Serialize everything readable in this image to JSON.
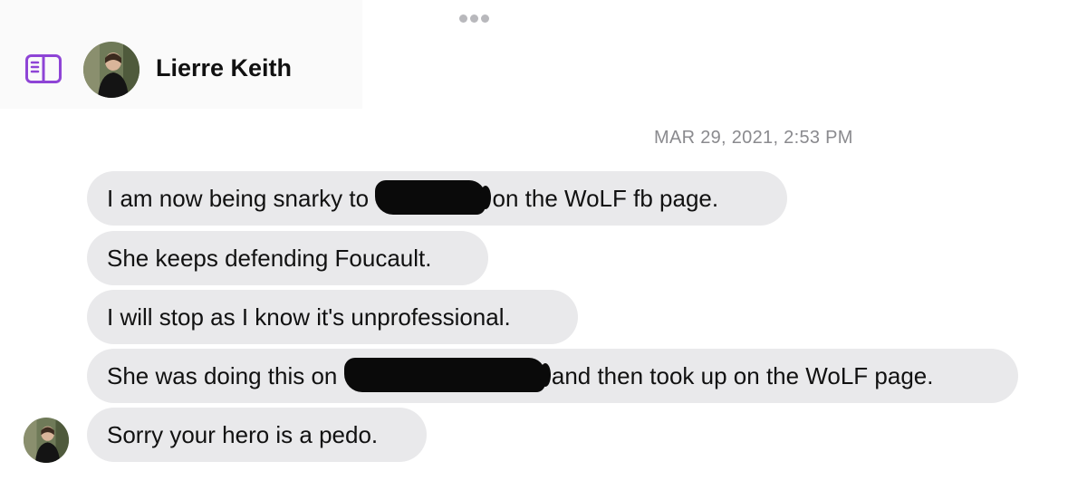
{
  "header": {
    "contact_name": "Lierre Keith",
    "accent_color": "#8e44d6"
  },
  "conversation": {
    "timestamp": "MAR 29, 2021, 2:53 PM",
    "messages": [
      {
        "before": "I am now being snarky to",
        "after": "on the WoLF fb page."
      },
      {
        "text": "She keeps defending Foucault."
      },
      {
        "text": "I will stop as I know it's unprofessional."
      },
      {
        "before": "She was doing this on",
        "after": "and then took up on the WoLF page."
      },
      {
        "text": "Sorry your hero is a pedo."
      }
    ]
  }
}
